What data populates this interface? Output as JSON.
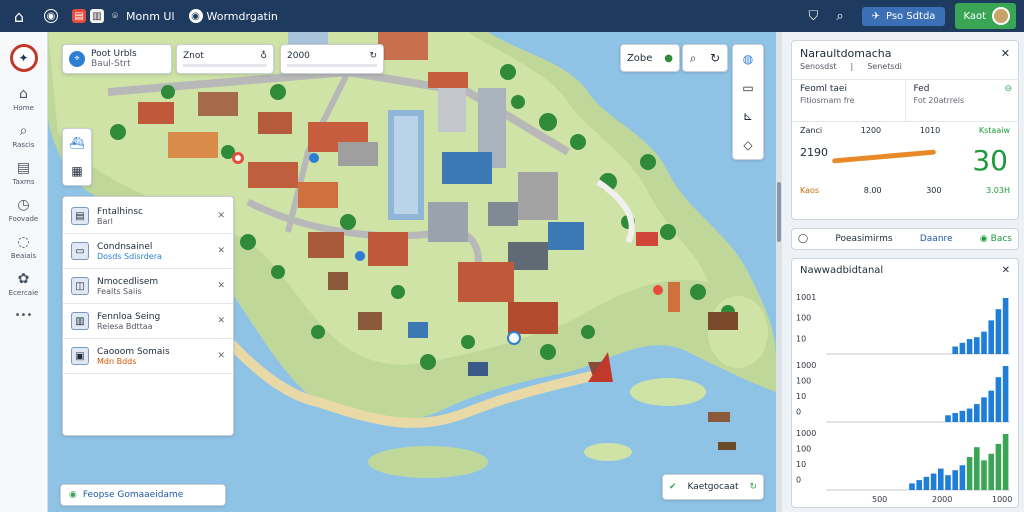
{
  "topbar": {
    "app_title": "Monm Ul",
    "location": "Wormdrgatin",
    "action_blue": "Pso Sdtda",
    "action_green": "Kaot",
    "colors": {
      "bg": "#1e3a5f",
      "blue": "#3b6fb6",
      "green": "#3aa655"
    }
  },
  "rail": {
    "items": [
      {
        "icon": "home-icon",
        "label": "Home"
      },
      {
        "icon": "search-icon",
        "label": "Rascis"
      },
      {
        "icon": "document-icon",
        "label": "Taxms"
      },
      {
        "icon": "compass-icon",
        "label": "Foovade"
      },
      {
        "icon": "location-icon",
        "label": "Beaiais"
      },
      {
        "icon": "settings-icon",
        "label": "Ecercaie"
      },
      {
        "icon": "more-icon",
        "label": "•••"
      }
    ]
  },
  "map": {
    "search": {
      "title": "Poot Urbls",
      "subtitle": "Baul-Strt"
    },
    "mini_cards": [
      {
        "left": "Znot",
        "right": ""
      },
      {
        "left": "2000",
        "right": ""
      }
    ],
    "tools_label": "Zobe",
    "layers": [
      {
        "title": "Fntalhinsc",
        "sub": "Barl",
        "sub_color": "normal"
      },
      {
        "title": "Condnsainel",
        "sub": "Dosds Sdisrdera",
        "sub_color": "blue"
      },
      {
        "title": "Nmocedlisem",
        "sub": "Fealts Saiis",
        "sub_color": "normal"
      },
      {
        "title": "Fennloa Seing",
        "sub": "Reiesa Bdttaa",
        "sub_color": "normal"
      },
      {
        "title": "Caooom Somais",
        "sub": "Mdn Bdds",
        "sub_color": "orange"
      }
    ],
    "status_pill": "Feopse Gomaaeidame",
    "status_ok": "Kaetgocaat"
  },
  "panel": {
    "title": "Naraultdomacha",
    "sub": [
      "Senosdst",
      "Senetsdi"
    ],
    "split_left": {
      "title": "Feoml taei",
      "sub": "Fitiosmam fre"
    },
    "split_right": {
      "title": "Fed",
      "sub": "Fot 20atrrels"
    },
    "metric": {
      "labels_top": [
        "Zanci",
        "1200",
        "1010",
        "Kstaaiw"
      ],
      "value_left": "2190",
      "labels_bottom": [
        "Kaos",
        "8.00",
        "300",
        "3.03H"
      ],
      "big_value": "30"
    },
    "filter": {
      "left": "Poeasimirms",
      "mid": "Daanre",
      "right": "Bacs"
    },
    "chart_title": "Nawwadbidtanal"
  },
  "chart_data": {
    "type": "bar",
    "title": "Nawwadbidtanal",
    "blocks": [
      {
        "ticks": [
          "1001",
          "100",
          "10"
        ],
        "values": [
          4,
          6,
          8,
          9,
          12,
          18,
          24,
          30
        ],
        "colors": [
          "#1f7fd8"
        ]
      },
      {
        "ticks": [
          "1000",
          "100",
          "10",
          "0"
        ],
        "values": [
          3,
          4,
          5,
          6,
          8,
          11,
          14,
          20,
          25
        ],
        "colors": [
          "#1f7fd8"
        ]
      },
      {
        "ticks": [
          "1000",
          "100",
          "10",
          "0"
        ],
        "values": [
          4,
          6,
          8,
          10,
          13,
          9,
          12,
          15,
          20,
          26,
          18,
          22,
          28,
          34
        ],
        "colors": [
          "#1f7fd8",
          "#1f7fd8",
          "#1f7fd8",
          "#1f7fd8",
          "#1f7fd8",
          "#1f7fd8",
          "#1f7fd8",
          "#1f7fd8",
          "#3aa655",
          "#3aa655",
          "#3aa655",
          "#3aa655",
          "#3aa655",
          "#3aa655"
        ]
      }
    ],
    "bottom_labels": [
      "500",
      "2000",
      "1000"
    ]
  }
}
